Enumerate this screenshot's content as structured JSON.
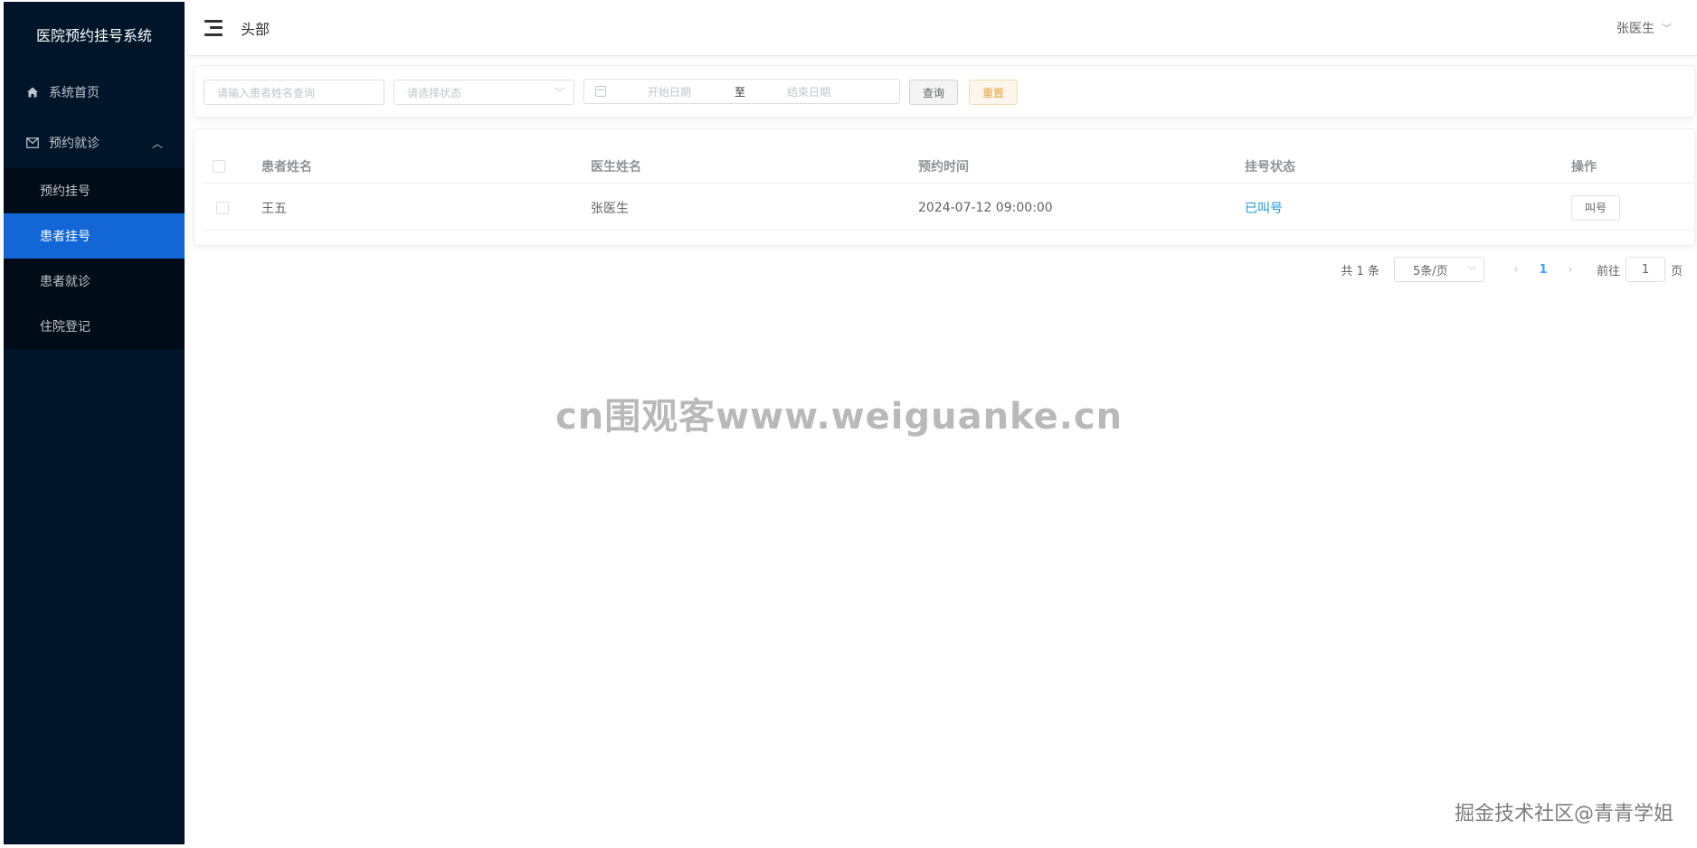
{
  "app": {
    "title": "医院预约挂号系统"
  },
  "sidebar": {
    "items": [
      {
        "label": "系统首页",
        "icon": "home-icon"
      },
      {
        "label": "预约就诊",
        "icon": "mail-icon",
        "expanded": true,
        "children": [
          {
            "label": "预约挂号",
            "active": false
          },
          {
            "label": "患者挂号",
            "active": true
          },
          {
            "label": "患者就诊",
            "active": false
          },
          {
            "label": "住院登记",
            "active": false
          }
        ]
      }
    ]
  },
  "header": {
    "title": "头部",
    "user": "张医生"
  },
  "filters": {
    "name_placeholder": "请输入患者姓名查询",
    "status_placeholder": "请选择状态",
    "start_placeholder": "开始日期",
    "range_separator": "至",
    "end_placeholder": "结束日期",
    "query_label": "查询",
    "reset_label": "重置"
  },
  "table": {
    "columns": [
      "患者姓名",
      "医生姓名",
      "预约时间",
      "挂号状态",
      "操作"
    ],
    "rows": [
      {
        "patient": "王五",
        "doctor": "张医生",
        "time": "2024-07-12 09:00:00",
        "status": "已叫号",
        "action": "叫号"
      }
    ]
  },
  "pagination": {
    "total": "共 1 条",
    "page_size": "5条/页",
    "current_page": "1",
    "goto_label": "前往",
    "goto_value": "1",
    "page_suffix": "页"
  },
  "watermarks": {
    "center": "cn围观客www.weiguanke.cn",
    "corner": "掘金技术社区@青青学姐"
  },
  "colors": {
    "sidebar_bg": "#001529",
    "active_item": "#1366d6",
    "status_link": "#1a9bd6",
    "reset_text": "#e6a23c",
    "page_active": "#409eff"
  }
}
